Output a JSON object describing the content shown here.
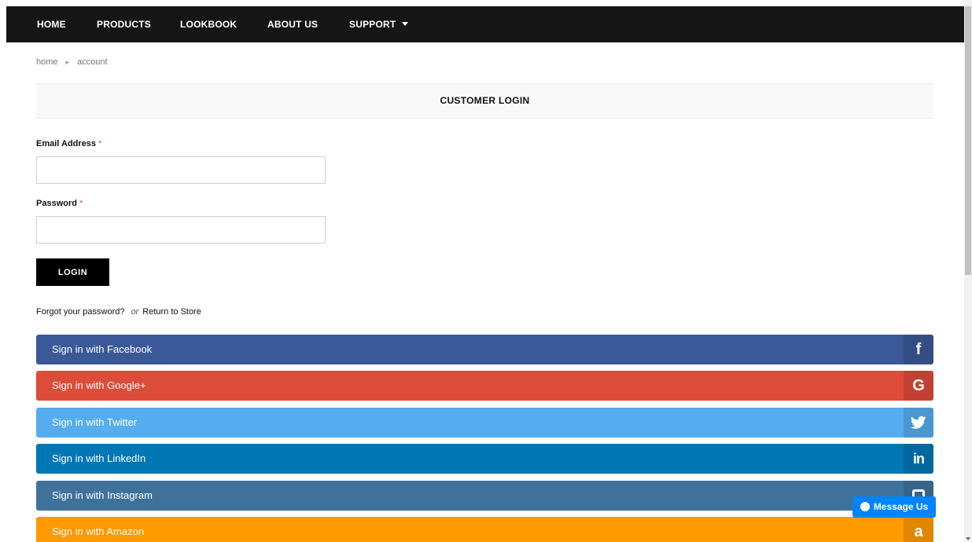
{
  "nav": {
    "home": "HOME",
    "products": "PRODUCTS",
    "lookbook": "LOOKBOOK",
    "about": "ABOUT US",
    "support": "SUPPORT"
  },
  "breadcrumb": {
    "home": "home",
    "current": "account"
  },
  "login": {
    "title": "CUSTOMER LOGIN",
    "email_label": "Email Address",
    "password_label": "Password",
    "required_mark": "*",
    "email_value": "",
    "password_value": "",
    "button_label": "LOGIN",
    "forgot_link": "Forgot your password?",
    "or_text": "or",
    "return_link": "Return to Store"
  },
  "social": {
    "facebook": {
      "label": "Sign in with Facebook",
      "icon": "facebook-icon",
      "glyph": "f",
      "color": "#3b5998"
    },
    "google": {
      "label": "Sign in with Google+",
      "icon": "google-icon",
      "glyph": "G",
      "color": "#dd4b39"
    },
    "twitter": {
      "label": "Sign in with Twitter",
      "icon": "twitter-icon",
      "color": "#55acee"
    },
    "linkedin": {
      "label": "Sign in with LinkedIn",
      "icon": "linkedin-icon",
      "glyph": "in",
      "color": "#0077b5"
    },
    "instagram": {
      "label": "Sign in with Instagram",
      "icon": "instagram-icon",
      "color": "#3f729b"
    },
    "amazon": {
      "label": "Sign in with Amazon",
      "icon": "amazon-icon",
      "glyph": "a",
      "color": "#ff9900"
    }
  },
  "messenger": {
    "label": "Message Us",
    "color": "#0084ff"
  }
}
